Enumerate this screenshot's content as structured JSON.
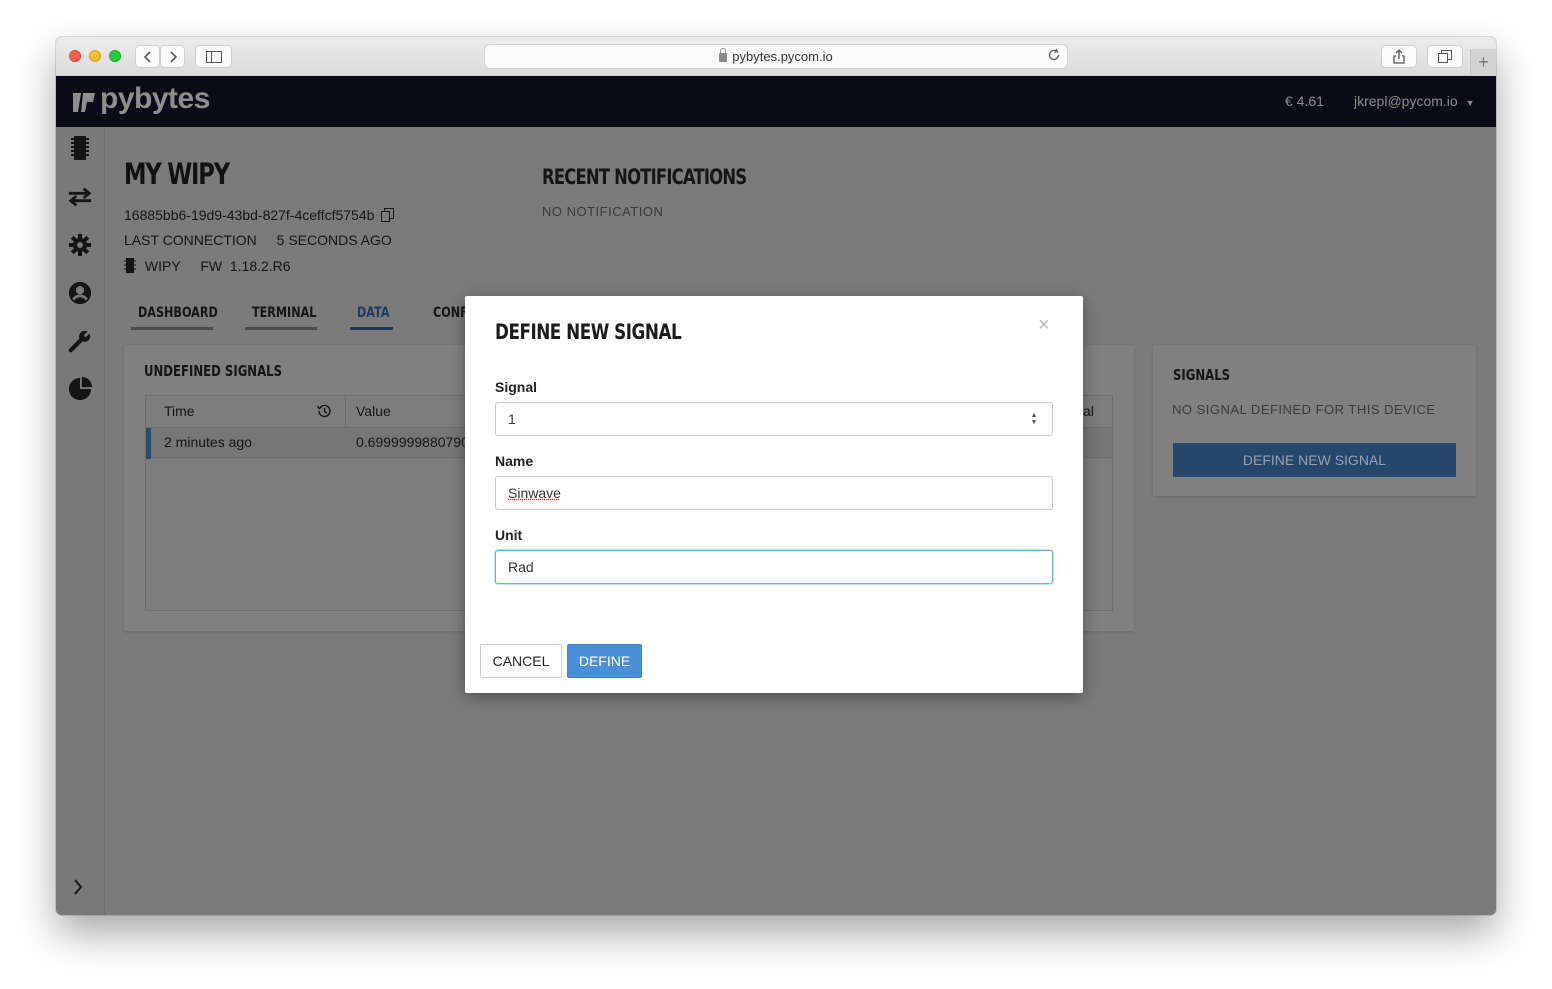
{
  "browser": {
    "url": "pybytes.pycom.io",
    "back_icon": "chevron-left-icon",
    "forward_icon": "chevron-right-icon",
    "sidebar_icon": "sidebar-toggle-icon",
    "reload_icon": "reload-icon",
    "share_icon": "share-icon",
    "tabs_icon": "tabs-icon",
    "new_tab_icon": "plus-icon"
  },
  "header": {
    "logo": "pybytes",
    "balance": "€ 4.61",
    "user": "jkrepl@pycom.io"
  },
  "sidebar": {
    "items": [
      {
        "icon": "device-chip-icon"
      },
      {
        "icon": "transfer-arrows-icon"
      },
      {
        "icon": "gear-icon"
      },
      {
        "icon": "user-icon"
      },
      {
        "icon": "wrench-icon"
      },
      {
        "icon": "pie-chart-icon"
      }
    ],
    "expand_icon": "chevron-right-icon"
  },
  "device": {
    "name": "MY WIPY",
    "id": "16885bb6-19d9-43bd-827f-4ceffcf5754b",
    "last_connection_label": "LAST CONNECTION",
    "last_connection_value": "5 SECONDS AGO",
    "type": "WIPY",
    "firmware": "FW  1.18.2.R6"
  },
  "notifications": {
    "title": "RECENT NOTIFICATIONS",
    "empty": "NO NOTIFICATION"
  },
  "tabs": [
    {
      "label": "DASHBOARD"
    },
    {
      "label": "TERMINAL"
    },
    {
      "label": "DATA",
      "active": true
    },
    {
      "label": "CONFI"
    }
  ],
  "undefined_signals": {
    "title": "UNDEFINED SIGNALS",
    "columns": [
      "Time",
      "Value",
      "al"
    ],
    "rows": [
      {
        "time": "2 minutes ago",
        "value": "0.6999999880790"
      }
    ]
  },
  "signals_panel": {
    "title": "SIGNALS",
    "empty": "NO SIGNAL DEFINED FOR THIS DEVICE",
    "button": "DEFINE NEW SIGNAL"
  },
  "modal": {
    "title": "DEFINE NEW SIGNAL",
    "close": "×",
    "signal_label": "Signal",
    "signal_value": "1",
    "name_label": "Name",
    "name_value": "Sinwave",
    "unit_label": "Unit",
    "unit_value": "Rad",
    "cancel": "CANCEL",
    "define": "DEFINE"
  },
  "colors": {
    "appbar": "#0a0b16",
    "primary": "#4a90d9",
    "overlay_gray": "#7b7b7b"
  }
}
